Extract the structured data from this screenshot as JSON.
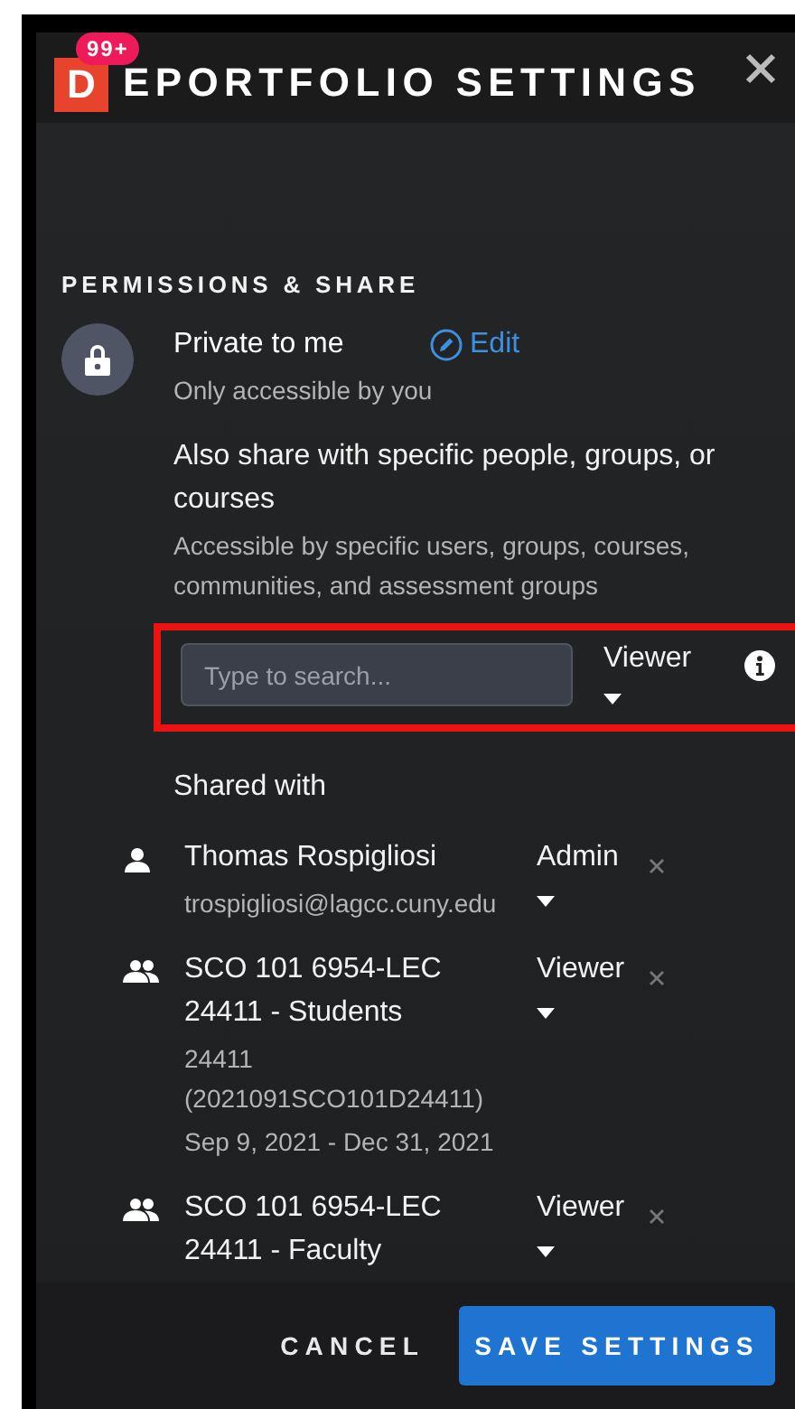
{
  "header": {
    "logo": "D",
    "badge": "99+",
    "title": "EPORTFOLIO SETTINGS"
  },
  "section_title": "PERMISSIONS & SHARE",
  "privacy": {
    "title": "Private to me",
    "edit": "Edit",
    "subtitle": "Only accessible by you"
  },
  "share": {
    "title": "Also share with specific people, groups, or courses",
    "description": "Accessible by specific users, groups, courses, communities, and assessment groups"
  },
  "search": {
    "placeholder": "Type to search...",
    "role": "Viewer",
    "highlighted": true
  },
  "shared_with": {
    "title": "Shared with",
    "entries": [
      {
        "kind": "user",
        "name": "Thomas Rospigliosi",
        "details": [
          "trospigliosi@lagcc.cuny.edu"
        ],
        "role": "Admin"
      },
      {
        "kind": "group",
        "name": "SCO 101 6954-LEC 24411 - Students",
        "details": [
          "24411 (2021091SCO101D24411)",
          "Sep 9, 2021 - Dec 31, 2021"
        ],
        "role": "Viewer"
      },
      {
        "kind": "group",
        "name": "SCO 101 6954-LEC 24411 - Faculty",
        "role": "Viewer"
      }
    ]
  },
  "buttons": [
    {
      "label": "CANCEL",
      "kind": "text"
    },
    {
      "label": "SAVE SETTINGS",
      "kind": "primary"
    }
  ]
}
